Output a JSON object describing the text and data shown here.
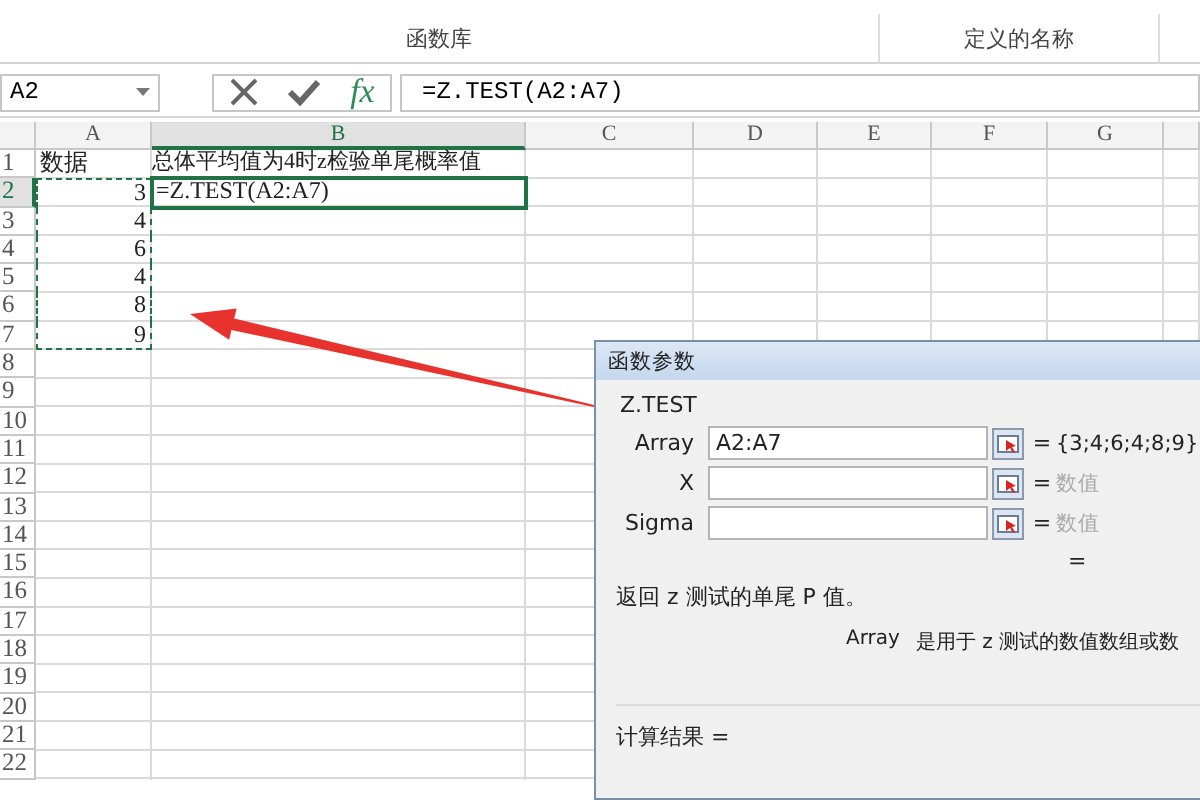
{
  "ribbon": {
    "groups": [
      {
        "label": "函数库"
      },
      {
        "label": "定义的名称"
      }
    ]
  },
  "formula_bar": {
    "name_box": "A2",
    "function_button": "fx",
    "formula": "=Z.TEST(A2:A7)"
  },
  "sheet": {
    "columns": [
      {
        "label": "A",
        "selected": false
      },
      {
        "label": "B",
        "selected": true
      },
      {
        "label": "C",
        "selected": false
      },
      {
        "label": "D",
        "selected": false
      },
      {
        "label": "E",
        "selected": false
      },
      {
        "label": "F",
        "selected": false
      },
      {
        "label": "G",
        "selected": false
      }
    ],
    "rows": [
      {
        "header": "1",
        "selected": false,
        "cells": [
          {
            "text": "数据",
            "kind": "text",
            "selected": false,
            "copied": false
          },
          {
            "text": "总体平均值为4时z检验单尾概率值",
            "kind": "text",
            "selected": false,
            "copied": false
          }
        ]
      },
      {
        "header": "2",
        "selected": true,
        "cells": [
          {
            "text": "3",
            "kind": "number",
            "selected": false,
            "copied": true
          },
          {
            "text": "=Z.TEST(A2:A7)",
            "kind": "text",
            "selected": true,
            "copied": false
          }
        ]
      },
      {
        "header": "3",
        "selected": false,
        "cells": [
          {
            "text": "4",
            "kind": "number",
            "selected": false,
            "copied": true
          }
        ]
      },
      {
        "header": "4",
        "selected": false,
        "cells": [
          {
            "text": "6",
            "kind": "number",
            "selected": false,
            "copied": true
          }
        ]
      },
      {
        "header": "5",
        "selected": false,
        "cells": [
          {
            "text": "4",
            "kind": "number",
            "selected": false,
            "copied": true
          }
        ]
      },
      {
        "header": "6",
        "selected": false,
        "cells": [
          {
            "text": "8",
            "kind": "number",
            "selected": false,
            "copied": true
          }
        ]
      },
      {
        "header": "7",
        "selected": false,
        "cells": [
          {
            "text": "9",
            "kind": "number",
            "selected": false,
            "copied": true
          }
        ]
      },
      {
        "header": "8",
        "selected": false,
        "cells": []
      },
      {
        "header": "9",
        "selected": false,
        "cells": []
      },
      {
        "header": "10",
        "selected": false,
        "cells": []
      },
      {
        "header": "11",
        "selected": false,
        "cells": []
      },
      {
        "header": "12",
        "selected": false,
        "cells": []
      },
      {
        "header": "13",
        "selected": false,
        "cells": []
      },
      {
        "header": "14",
        "selected": false,
        "cells": []
      },
      {
        "header": "15",
        "selected": false,
        "cells": []
      },
      {
        "header": "16",
        "selected": false,
        "cells": []
      },
      {
        "header": "17",
        "selected": false,
        "cells": []
      },
      {
        "header": "18",
        "selected": false,
        "cells": []
      },
      {
        "header": "19",
        "selected": false,
        "cells": []
      },
      {
        "header": "20",
        "selected": false,
        "cells": []
      },
      {
        "header": "21",
        "selected": false,
        "cells": []
      },
      {
        "header": "22",
        "selected": false,
        "cells": []
      }
    ]
  },
  "dialog": {
    "title": "函数参数",
    "function_name": "Z.TEST",
    "arguments": [
      {
        "name": "Array",
        "value": "A2:A7",
        "equals": "=",
        "result": "{3;4;6;4;8;9}",
        "result_dimmed": false
      },
      {
        "name": "X",
        "equals": "=",
        "result": "数值",
        "result_dimmed": true
      },
      {
        "name": "Sigma",
        "equals": "=",
        "result": "数值",
        "result_dimmed": true
      }
    ],
    "total_equals": "=",
    "description": "返回 z 测试的单尾 P 值。",
    "arg_name": "Array",
    "arg_help": "是用于 z 测试的数值数组或数",
    "result_label": "计算结果 ="
  }
}
